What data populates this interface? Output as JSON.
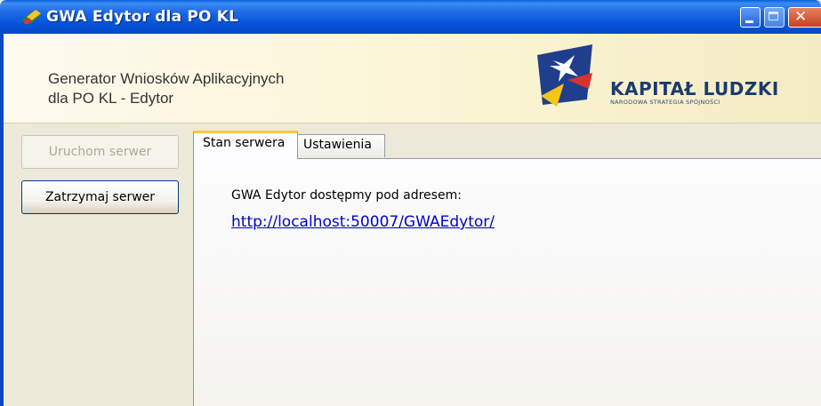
{
  "window": {
    "title": "GWA Edytor dla PO KL"
  },
  "header": {
    "title": "Generator Wniosków Aplikacyjnych\ndla PO KL - Edytor",
    "logo_name": "KAPITAŁ LUDZKI",
    "logo_subtitle": "NARODOWA STRATEGIA SPÓJNOŚCI"
  },
  "buttons": {
    "start_server": "Uruchom serwer",
    "stop_server": "Zatrzymaj serwer"
  },
  "tabs": [
    {
      "label": "Stan serwera",
      "selected": true
    },
    {
      "label": "Ustawienia",
      "selected": false
    }
  ],
  "status_panel": {
    "label": "GWA Edytor dostępmy pod adresem:",
    "url": "http://localhost:50007/GWAEdytor/"
  },
  "icons": {
    "app": "app-flag-icon",
    "minimize": "minimize-icon",
    "maximize": "maximize-icon",
    "close": "close-icon",
    "logo": "kapital-ludzki-logo-icon"
  },
  "colors": {
    "titlebar": "#0553d9",
    "link": "#0000d0",
    "tab_highlight": "#ffc83c"
  }
}
